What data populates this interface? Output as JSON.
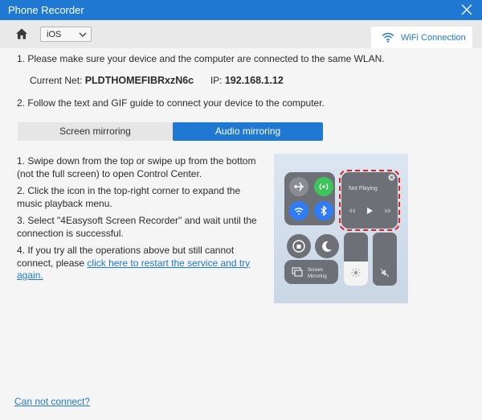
{
  "window": {
    "title": "Phone Recorder",
    "close_icon": "close-icon"
  },
  "toolbar": {
    "home_icon": "home-icon",
    "os_select": {
      "value": "iOS",
      "icon": "chevron-down-icon"
    },
    "wifi_tab": {
      "label": "WiFi Connection",
      "icon": "wifi-icon"
    }
  },
  "instructions": {
    "step1": "1. Please make sure your device and the computer are connected to the same WLAN.",
    "current_net_label": "Current Net:",
    "current_net_value": "PLDTHOMEFIBRxzN6c",
    "ip_label": "IP:",
    "ip_value": "192.168.1.12",
    "step2": "2. Follow the text and GIF guide to connect your device to the computer."
  },
  "tabs": {
    "screen_mirroring": "Screen mirroring",
    "audio_mirroring": "Audio mirroring",
    "active": "audio_mirroring"
  },
  "guide": {
    "s1": "1. Swipe down from the top or swipe up from the bottom (not the full screen) to open Control Center.",
    "s2": "2. Click the icon in the top-right corner to expand the music playback menu.",
    "s3": "3. Select \"4Easysoft Screen Recorder\" and wait until the connection is successful.",
    "s4_prefix": "4. If you try all the operations above but still cannot connect, please ",
    "s4_link": "click here to restart the service and try again."
  },
  "control_center": {
    "now_playing": "Not Playing",
    "screen_mirroring_line1": "Screen",
    "screen_mirroring_line2": "Mirroring"
  },
  "footer": {
    "cant_connect": "Can not connect?"
  },
  "colors": {
    "accent": "#1f78d1",
    "highlight": "#e02020"
  }
}
